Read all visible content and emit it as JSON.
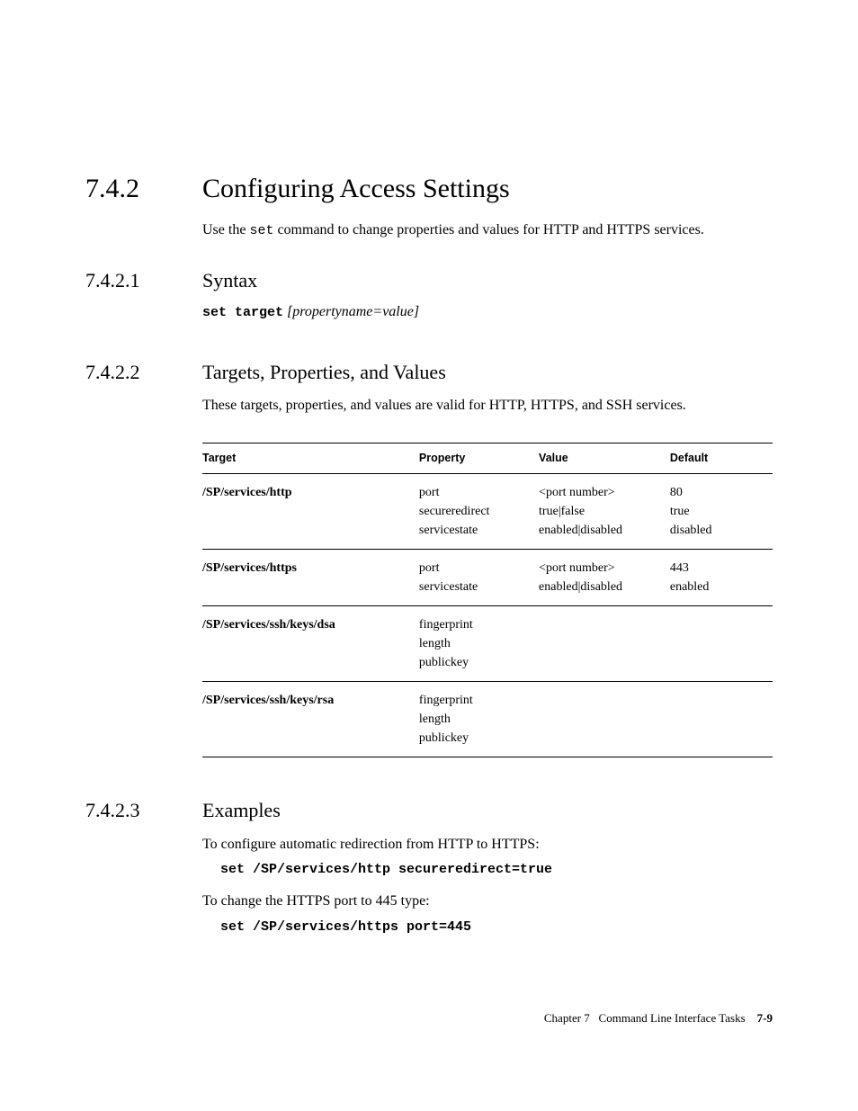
{
  "sections": {
    "s742": {
      "num": "7.4.2",
      "title": "Configuring Access Settings"
    },
    "s7421": {
      "num": "7.4.2.1",
      "title": "Syntax"
    },
    "s7422": {
      "num": "7.4.2.2",
      "title": "Targets, Properties, and Values"
    },
    "s7423": {
      "num": "7.4.2.3",
      "title": "Examples"
    }
  },
  "intro": {
    "pre": "Use the ",
    "cmd": "set",
    "post": " command to change properties and values for HTTP and HTTPS services."
  },
  "syntax": {
    "cmd": "set target",
    "args": " [propertyname=value]"
  },
  "tpv_intro": "These targets, properties, and values are valid for HTTP, HTTPS, and SSH services.",
  "table": {
    "headers": {
      "target": "Target",
      "property": "Property",
      "value": "Value",
      "default": "Default"
    },
    "rows": [
      {
        "target": "/SP/services/http",
        "property": "port\nsecureredirect\nservicestate",
        "value": "<port number>\ntrue|false\nenabled|disabled",
        "default": "80\ntrue\ndisabled"
      },
      {
        "target": "/SP/services/https",
        "property": "port\nservicestate",
        "value": "<port number>\nenabled|disabled",
        "default": "443\nenabled"
      },
      {
        "target": "/SP/services/ssh/keys/dsa",
        "property": "fingerprint\nlength\npublickey",
        "value": "",
        "default": ""
      },
      {
        "target": "/SP/services/ssh/keys/rsa",
        "property": "fingerprint\nlength\npublickey",
        "value": "",
        "default": ""
      }
    ]
  },
  "examples": {
    "p1": "To configure automatic redirection from HTTP to HTTPS:",
    "c1": "set /SP/services/http secureredirect=true",
    "p2": "To change the HTTPS port to 445 type:",
    "c2": "set /SP/services/https port=445"
  },
  "footer": {
    "chapter": "Chapter 7",
    "title": "Command Line Interface Tasks",
    "page": "7-9"
  }
}
